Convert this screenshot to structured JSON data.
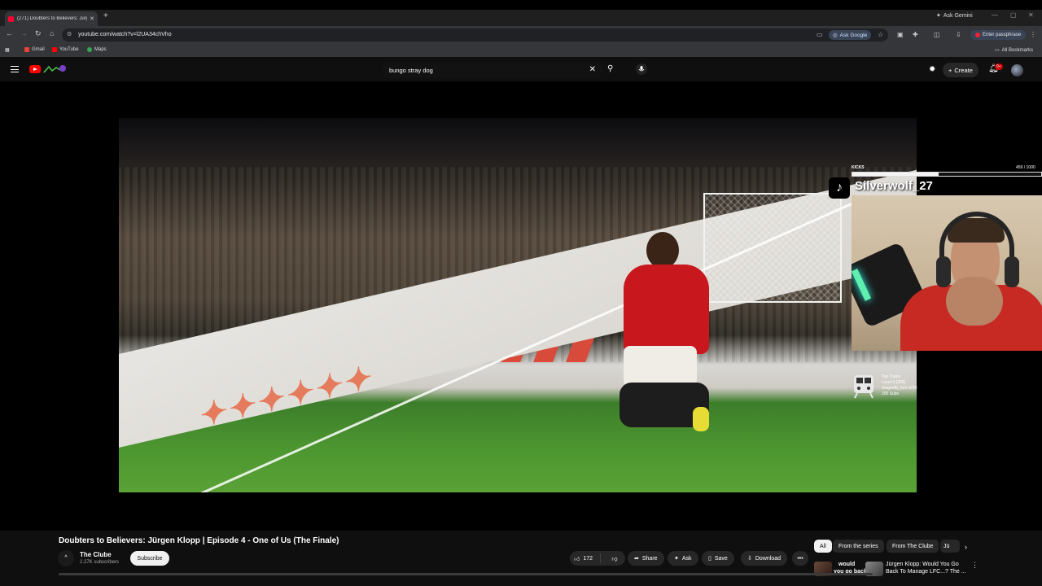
{
  "browser": {
    "tab": {
      "title": "(271) Doubters to Believers: Jürg",
      "close": "✕"
    },
    "new_tab": "+",
    "gemini_tab": "Ask Gemini",
    "window_controls": [
      "—",
      "▢",
      "✕"
    ],
    "url": "youtube.com/watch?v=l2UA34chVho",
    "ask_google": "Ask Google",
    "passphrase": "Enter passphrase",
    "bookmarks": [
      {
        "label": "Gmail",
        "color": "#ea4335"
      },
      {
        "label": "YouTube",
        "color": "#ff0000"
      },
      {
        "label": "Maps",
        "color": "#34a853"
      }
    ],
    "all_bookmarks": "All Bookmarks"
  },
  "youtube": {
    "search": {
      "query": "bungo stray dog"
    },
    "create_label": "Create",
    "notifications_badge": "9+"
  },
  "overlay": {
    "kicks_label": "KICKS",
    "kicks_count": "459 / 1000",
    "kicks_progress": 0.459,
    "streamer_name": "Silverwolf_27",
    "top_train": [
      "Top Trains",
      "Level 9 (265)",
      "dragonfly_kev x200",
      "200 Subs"
    ]
  },
  "video": {
    "title": "Doubters to Believers: Jürgen Klopp | Episode 4 - One of Us (The Finale)",
    "channel": "The Clube",
    "channel_avatar": "^",
    "subscribers": "2.27K subscribers",
    "subscribe_label": "Subscribe",
    "likes": "172",
    "share_label": "Share",
    "ask_label": "Ask",
    "save_label": "Save",
    "download_label": "Download"
  },
  "chips": [
    "All",
    "From the series",
    "From The Clube",
    "Jü"
  ],
  "recommendations": [
    {
      "title_line1": "would",
      "title_line2": "you go back..."
    },
    {
      "title_line1": "Jürgen Klopp: Would You Go",
      "title_line2": "Back To Manage LFC...? The ..."
    }
  ],
  "colors": {
    "brand_red": "#ff0000",
    "subscribe_bg": "#f1f1f1",
    "jersey": "#c8181e"
  }
}
